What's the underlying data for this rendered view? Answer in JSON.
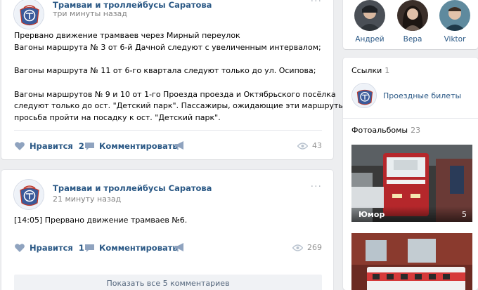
{
  "posts": [
    {
      "author": "Трамваи и троллейбусы Саратова",
      "time": "три минуты назад",
      "lines": [
        "Прервано движение трамваев через Мирный переулок",
        "Вагоны маршрута № 3 от 6-й Дачной следуют с увеличенным интервалом;",
        "",
        "Вагоны маршрута № 11 от 6-го квартала следуют только до ул. Осипова;",
        "",
        "Вагоны маршрутов № 9 и 10 от 1-го Проезда проезда и Октябрьского посёлка",
        "следуют только до ост. \"Детский парк\". Пассажиры, ожидающие эти маршруты,",
        "просьба пройти на посадку к ост. \"Детский парк\"."
      ],
      "like_label": "Нравится",
      "like_count": "2",
      "comment_label": "Комментировать",
      "views": "43"
    },
    {
      "author": "Трамваи и троллейбусы Саратова",
      "time": "21 минуту назад",
      "lines": [
        "[14:05] Прервано движение трамваев №6."
      ],
      "like_label": "Нравится",
      "like_count": "1",
      "comment_label": "Комментировать",
      "views": "269",
      "show_all": "Показать все 5 комментариев"
    }
  ],
  "sidebar": {
    "friends": [
      {
        "name": "Андрей"
      },
      {
        "name": "Вера"
      },
      {
        "name": "Viktor"
      }
    ],
    "links_header": "Ссылки",
    "links_count": "1",
    "link_label": "Проездные билеты",
    "albums_header": "Фотоальбомы",
    "albums_count": "23",
    "albums": [
      {
        "title": "Юмор",
        "count": "5"
      },
      {
        "title": "",
        "count": ""
      }
    ]
  },
  "colors": {
    "link": "#2a5885",
    "background": "#edeef0",
    "muted": "#828282"
  }
}
